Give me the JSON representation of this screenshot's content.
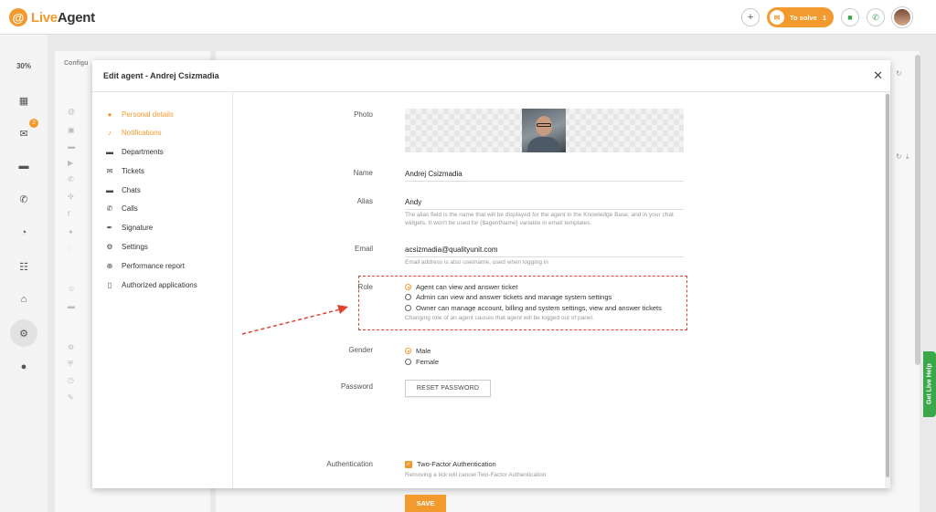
{
  "app": {
    "logo_text_1": "Live",
    "logo_text_2": "Agent"
  },
  "topbar": {
    "to_solve_label": "To solve",
    "to_solve_count": "1"
  },
  "leftnav": {
    "percent": "30%",
    "email_badge": "2"
  },
  "background": {
    "panel_title": "Configu"
  },
  "live_help": {
    "label": "Get Live Help"
  },
  "modal": {
    "title": "Edit agent - Andrej Csizmadia",
    "menu": [
      {
        "label": "Personal details",
        "icon": "person-icon"
      },
      {
        "label": "Notifications",
        "icon": "bell-icon"
      },
      {
        "label": "Departments",
        "icon": "folder-icon"
      },
      {
        "label": "Tickets",
        "icon": "envelope-icon"
      },
      {
        "label": "Chats",
        "icon": "chat-icon"
      },
      {
        "label": "Calls",
        "icon": "phone-icon"
      },
      {
        "label": "Signature",
        "icon": "signature-icon"
      },
      {
        "label": "Settings",
        "icon": "gear-icon"
      },
      {
        "label": "Performance report",
        "icon": "globe-icon"
      },
      {
        "label": "Authorized applications",
        "icon": "mobile-icon"
      }
    ],
    "form": {
      "photo_label": "Photo",
      "name_label": "Name",
      "name_value": "Andrej Csizmadia",
      "alias_label": "Alias",
      "alias_value": "Andy",
      "alias_hint": "The alias field is the name that will be displayed for the agent in the Knowledge Base, and in your chat widgets. It won't be used for {$agentName} variable in email templates.",
      "email_label": "Email",
      "email_value": "acsizmadia@qualityunit.com",
      "email_hint": "Email address is also username, used when logging in",
      "role_label": "Role",
      "role_options": [
        "Agent can view and answer ticket",
        "Admin can view and answer tickets and manage system settings",
        "Owner can manage account, billing and system settings, view and answer tickets"
      ],
      "role_selected_index": 0,
      "role_hint": "Changing role of an agent causes that agent will be logged out of panel.",
      "gender_label": "Gender",
      "gender_options": [
        "Male",
        "Female"
      ],
      "gender_selected_index": 0,
      "password_label": "Password",
      "reset_password_label": "RESET PASSWORD",
      "auth_label": "Authentication",
      "two_factor_label": "Two-Factor Authentication",
      "two_factor_checked": true,
      "two_factor_hint": "Removing a tick will cancel Two-Factor Authentication",
      "save_label": "SAVE"
    }
  },
  "colors": {
    "accent": "#f39a2e",
    "annotation": "#e0432c",
    "live_help": "#3aa84a"
  }
}
